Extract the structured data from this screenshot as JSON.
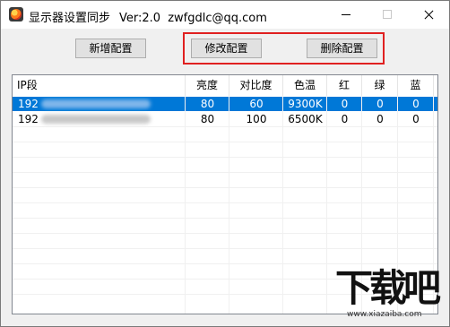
{
  "window": {
    "title": "显示器设置同步",
    "version": "Ver:2.0",
    "email": "zwfgdlc@qq.com"
  },
  "toolbar": {
    "add_label": "新增配置",
    "edit_label": "修改配置",
    "delete_label": "删除配置"
  },
  "table": {
    "columns": [
      "IP段",
      "亮度",
      "对比度",
      "色温",
      "红",
      "绿",
      "蓝"
    ],
    "rows": [
      {
        "ip": "192",
        "brightness": "80",
        "contrast": "60",
        "color_temp": "9300K",
        "red": "0",
        "green": "0",
        "blue": "0",
        "selected": true
      },
      {
        "ip": "192",
        "brightness": "80",
        "contrast": "100",
        "color_temp": "6500K",
        "red": "0",
        "green": "0",
        "blue": "0",
        "selected": false
      }
    ]
  },
  "watermark": {
    "logo_text": "下载吧",
    "url": "www.xiazaiba.com"
  },
  "colors": {
    "selection": "#0078d7",
    "highlight_border": "#e02020"
  }
}
